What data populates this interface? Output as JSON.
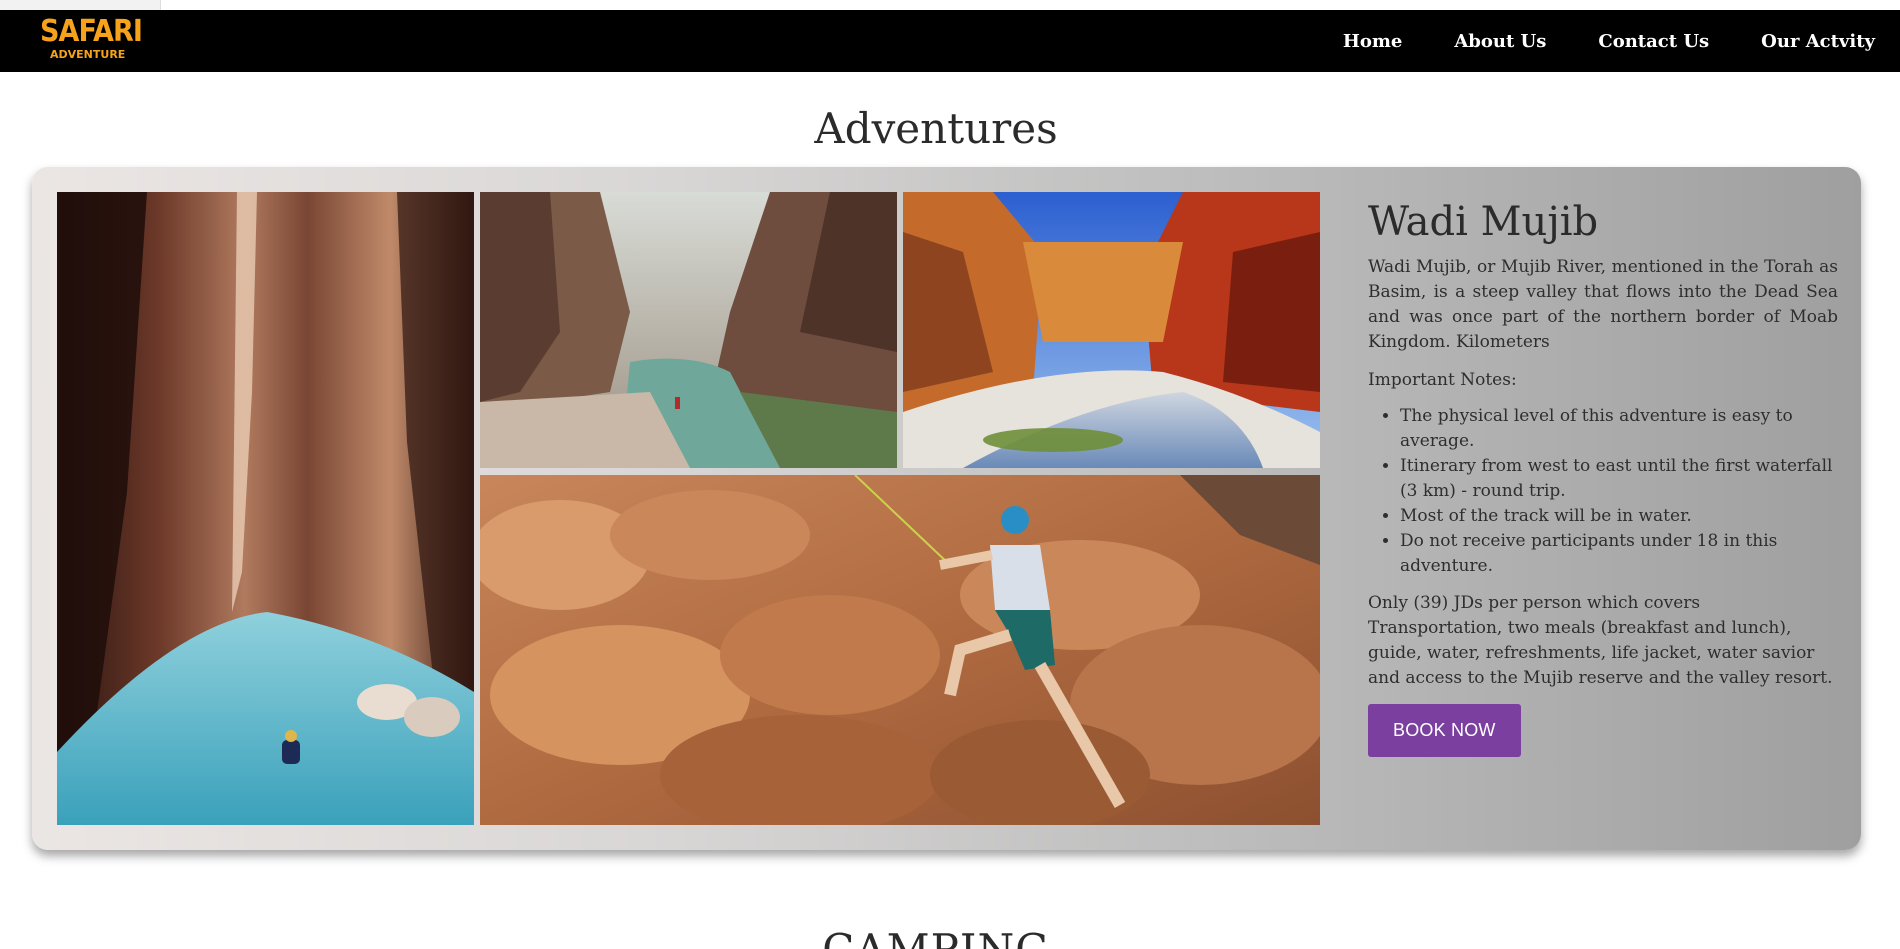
{
  "brand": {
    "logo_line1": "SAFARI",
    "logo_line2": "ADVENTURE",
    "color": "#f6a31b"
  },
  "nav": {
    "items": [
      "Home",
      "About Us",
      "Contact Us",
      "Our Actvity"
    ]
  },
  "section_title": "Adventures",
  "card": {
    "title": "Wadi Mujib",
    "description": "Wadi Mujib, or Mujib River, mentioned in the Torah as Basim, is a steep valley that flows into the Dead Sea and was once part of the northern border of Moab Kingdom. Kilometers",
    "notes_label": "Important Notes:",
    "notes": [
      "The physical level of this adventure is easy to average.",
      "Itinerary from west to east until the first waterfall (3 km) - round trip.",
      "Most of the track will be in water.",
      "Do not receive participants under 18 in this adventure."
    ],
    "price_text": "Only (39) JDs per person which covers Transportation, two meals (breakfast and lunch), guide, water, refreshments, life jacket, water savior and access to the Mujib reserve and the valley resort.",
    "button_label": "BOOK NOW",
    "button_color": "#7b3fa0"
  },
  "next_section_title": "CAMPING"
}
